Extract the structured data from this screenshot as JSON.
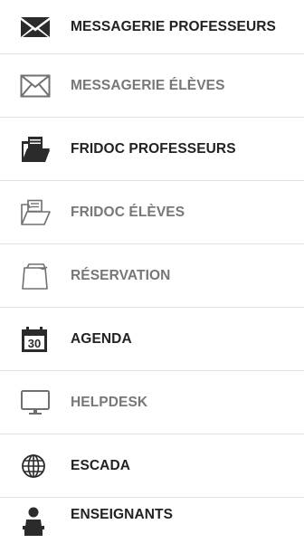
{
  "menu": {
    "items": [
      {
        "label": "MESSAGERIE PROFESSEURS",
        "icon": "envelope-filled-icon",
        "tone": "dark"
      },
      {
        "label": "MESSAGERIE ÉLÈVES",
        "icon": "envelope-outline-icon",
        "tone": "gray"
      },
      {
        "label": "FRIDOC PROFESSEURS",
        "icon": "folder-filled-icon",
        "tone": "dark"
      },
      {
        "label": "FRIDOC ÉLÈVES",
        "icon": "folder-outline-icon",
        "tone": "gray"
      },
      {
        "label": "RÉSERVATION",
        "icon": "notepad-icon",
        "tone": "gray"
      },
      {
        "label": "AGENDA",
        "icon": "calendar-icon",
        "tone": "dark",
        "icon_text": "30"
      },
      {
        "label": "HELPDESK",
        "icon": "monitor-icon",
        "tone": "gray"
      },
      {
        "label": "ESCADA",
        "icon": "globe-icon",
        "tone": "dark"
      },
      {
        "label": "ENSEIGNANTS",
        "icon": "teacher-icon",
        "tone": "dark"
      }
    ]
  },
  "colors": {
    "dark_text": "#222222",
    "gray_text": "#777777",
    "divider": "#e3e3e3",
    "icon_dark": "#2b2b2b",
    "icon_gray": "#707070"
  }
}
